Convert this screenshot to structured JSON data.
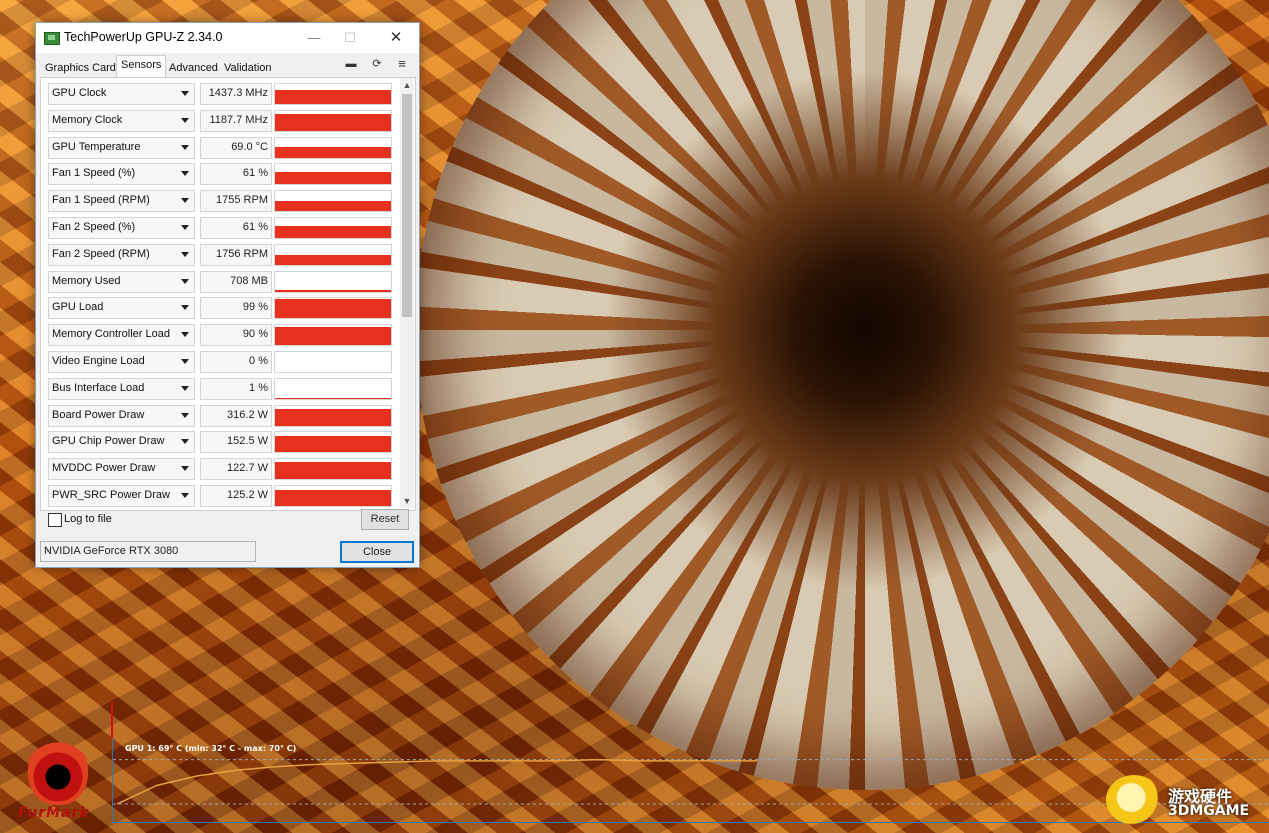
{
  "window": {
    "title": "TechPowerUp GPU-Z 2.34.0",
    "tabs": [
      {
        "label": "Graphics Card",
        "active": false
      },
      {
        "label": "Sensors",
        "active": true
      },
      {
        "label": "Advanced",
        "active": false
      },
      {
        "label": "Validation",
        "active": false
      }
    ],
    "icons": [
      "camera-icon",
      "refresh-icon",
      "menu-icon"
    ]
  },
  "sensors": [
    {
      "name": "GPU Clock",
      "value": "1437.3 MHz",
      "fill": 0.7
    },
    {
      "name": "Memory Clock",
      "value": "1187.7 MHz",
      "fill": 0.85
    },
    {
      "name": "GPU Temperature",
      "value": "69.0 °C",
      "fill": 0.55
    },
    {
      "name": "Fan 1 Speed (%)",
      "value": "61 %",
      "fill": 0.6
    },
    {
      "name": "Fan 1 Speed (RPM)",
      "value": "1755 RPM",
      "fill": 0.5
    },
    {
      "name": "Fan 2 Speed (%)",
      "value": "61 %",
      "fill": 0.6
    },
    {
      "name": "Fan 2 Speed (RPM)",
      "value": "1756 RPM",
      "fill": 0.5
    },
    {
      "name": "Memory Used",
      "value": "708 MB",
      "fill": 0.06
    },
    {
      "name": "GPU Load",
      "value": "99 %",
      "fill": 0.95
    },
    {
      "name": "Memory Controller Load",
      "value": "90 %",
      "fill": 0.9
    },
    {
      "name": "Video Engine Load",
      "value": "0 %",
      "fill": 0
    },
    {
      "name": "Bus Interface Load",
      "value": "1 %",
      "fill": 0.02
    },
    {
      "name": "Board Power Draw",
      "value": "316.2 W",
      "fill": 0.85
    },
    {
      "name": "GPU Chip Power Draw",
      "value": "152.5 W",
      "fill": 0.8
    },
    {
      "name": "MVDDC Power Draw",
      "value": "122.7 W",
      "fill": 0.85
    },
    {
      "name": "PWR_SRC Power Draw",
      "value": "125.2 W",
      "fill": 0.8
    }
  ],
  "footer": {
    "log_label": "Log to file",
    "log_checked": false,
    "reset_label": "Reset",
    "device": "NVIDIA GeForce RTX 3080",
    "close_label": "Close"
  },
  "furmark": {
    "graph_label": "GPU 1: 69° C (min: 32° C - max: 70° C)",
    "logo_text": "FurMark",
    "temp_series_c": [
      32,
      48,
      56,
      61,
      64,
      66,
      67,
      68,
      69,
      69,
      69,
      69,
      70,
      69,
      69,
      69,
      69
    ]
  },
  "watermark": {
    "cn": "游戏硬件",
    "en": "3DMGAME"
  },
  "colors": {
    "bar": "#e8301e",
    "graph_line": "#e8a040",
    "graph_axis": "#2a7ab5"
  }
}
